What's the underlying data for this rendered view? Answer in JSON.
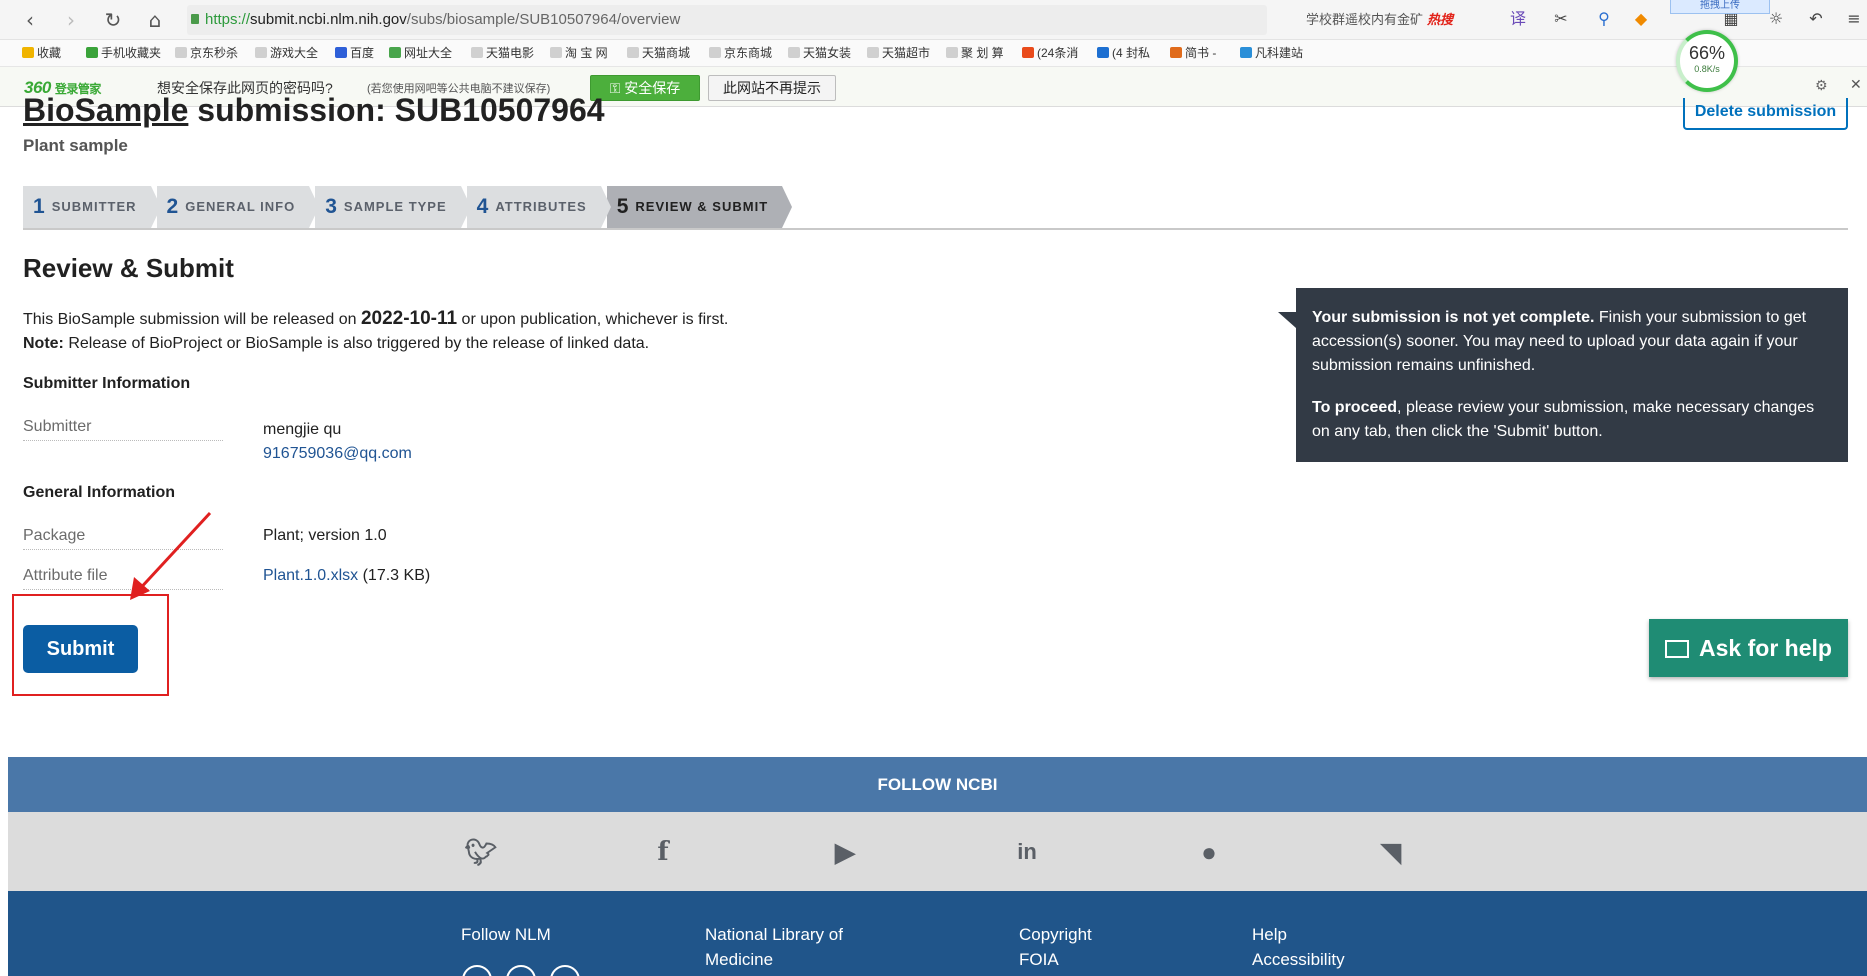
{
  "browser": {
    "url_protocol": "https://",
    "url_host": "submit.ncbi.nlm.nih.gov",
    "url_path": "/subs/biosample/SUB10507964/overview",
    "search_text": "学校群遥校内有金矿",
    "search_hot": "热搜",
    "upload_tab": "拖拽上传",
    "speed_percent": "66%",
    "speed_rate": "0.8K/s"
  },
  "bookmarks": [
    "收藏",
    "手机收藏夹",
    "京东秒杀",
    "游戏大全",
    "百度",
    "网址大全",
    "天猫电影",
    "淘 宝 网",
    "天猫商城",
    "京东商城",
    "天猫女装",
    "天猫超市",
    "聚 划 算",
    "(24条消",
    "(4 封私",
    "简书 -",
    "凡科建站"
  ],
  "password_bar": {
    "brand": "360",
    "brand_suffix": "登录管家",
    "message": "想安全保存此网页的密码吗?",
    "hint": "(若您使用网吧等公共电脑不建议保存)",
    "save_button": "安全保存",
    "no_prompt_button": "此网站不再提示"
  },
  "page": {
    "title_link": "BioSample",
    "title_rest": " submission: SUB10507964",
    "subtitle": "Plant sample",
    "delete_button": "Delete submission",
    "steps": [
      {
        "num": "1",
        "label": "Submitter"
      },
      {
        "num": "2",
        "label": "General Info"
      },
      {
        "num": "3",
        "label": "Sample type"
      },
      {
        "num": "4",
        "label": "Attributes"
      },
      {
        "num": "5",
        "label": "Review & Submit"
      }
    ],
    "section_title": "Review & Submit",
    "release_prefix": "This BioSample submission will be released on ",
    "release_date": "2022-10-11",
    "release_suffix": " or upon publication, whichever is first.",
    "note_label": "Note:",
    "note_text": " Release of BioProject or BioSample is also triggered by the release of linked data.",
    "submitter_heading": "Submitter Information",
    "submitter_label": "Submitter",
    "submitter_name": "mengjie qu",
    "submitter_email": "916759036@qq.com",
    "general_heading": "General Information",
    "package_label": "Package",
    "package_value": "Plant; version 1.0",
    "attr_label": "Attribute file",
    "attr_file": "Plant.1.0.xlsx",
    "attr_size": " (17.3 KB)",
    "submit_button": "Submit",
    "alert_bold1": "Your submission is not yet complete.",
    "alert_text1": " Finish your submission to get accession(s) sooner. You may need to upload your data again if your submission remains unfinished.",
    "alert_bold2": "To proceed",
    "alert_text2": ", please review your submission, make necessary changes on any tab, then click the 'Submit' button.",
    "ask_help": "Ask for help"
  },
  "footer": {
    "follow": "FOLLOW NCBI",
    "social_icons": [
      "twitter-icon",
      "facebook-icon",
      "youtube-icon",
      "linkedin-icon",
      "github-icon",
      "rss-icon"
    ],
    "follow_nlm": "Follow NLM",
    "nlm_line1": "National Library of",
    "nlm_line2": "Medicine",
    "copyright": "Copyright",
    "foia": "FOIA",
    "help": "Help",
    "accessibility": "Accessibility"
  }
}
